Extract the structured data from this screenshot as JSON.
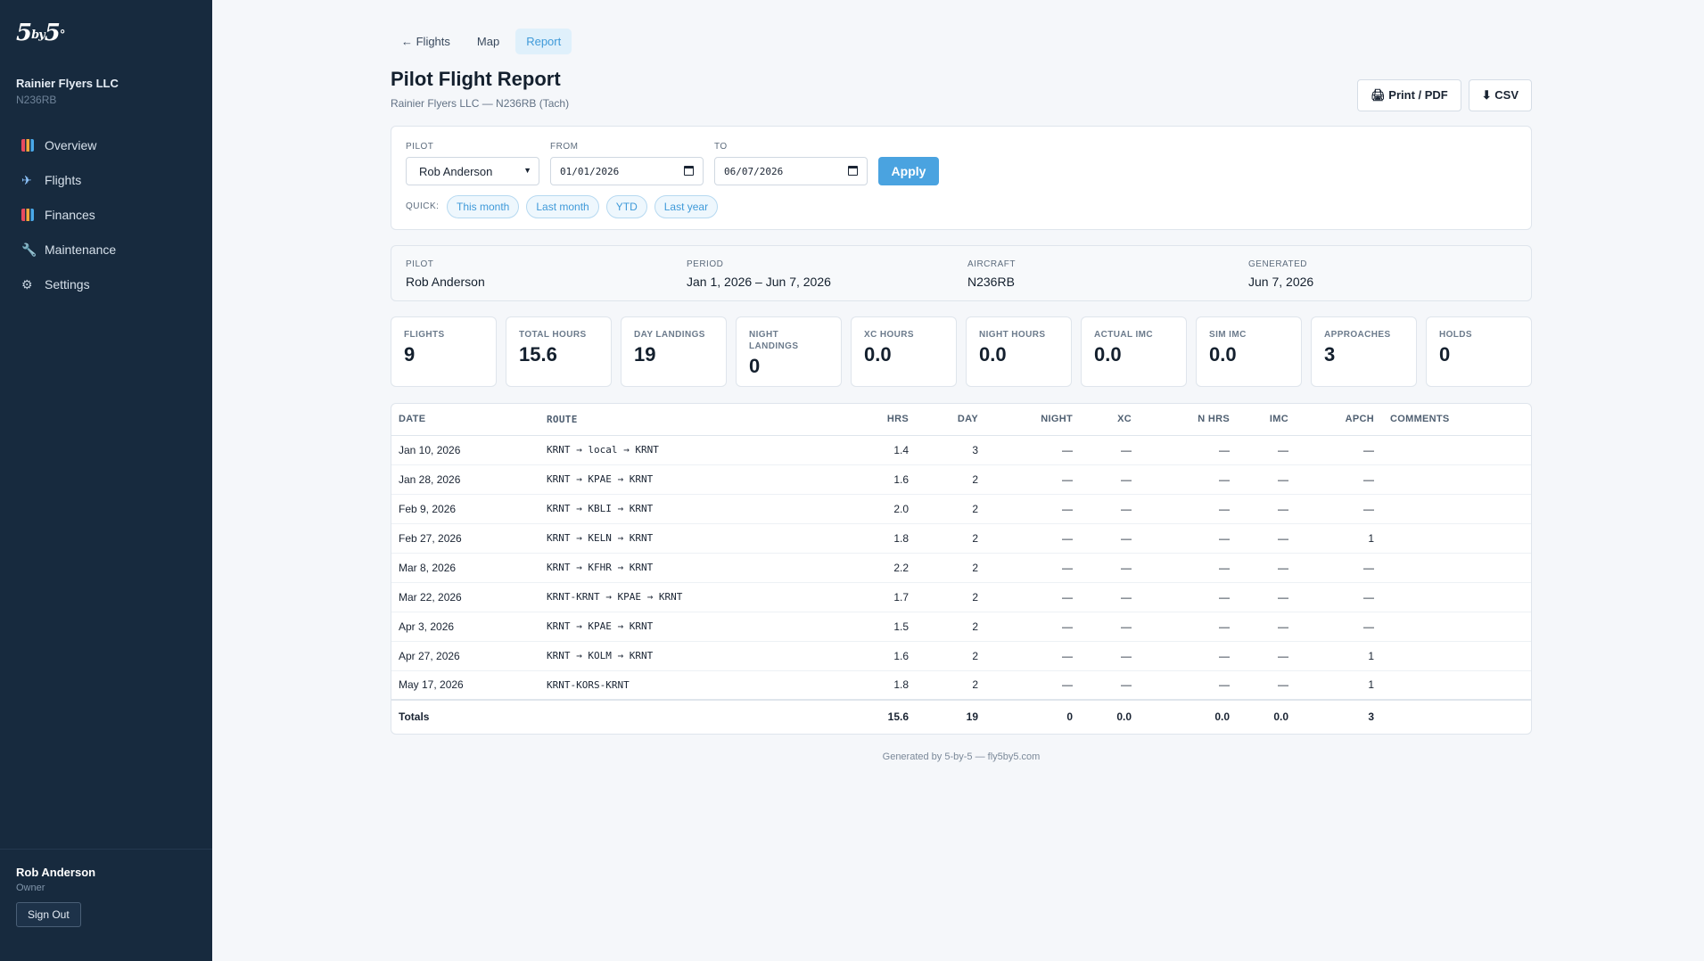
{
  "brand": {
    "logo_main": "5by5",
    "org_name": "Rainier Flyers LLC",
    "tail": "N236RB"
  },
  "nav": [
    {
      "label": "Overview",
      "icon": "chart-icon"
    },
    {
      "label": "Flights",
      "icon": "plane-icon"
    },
    {
      "label": "Finances",
      "icon": "chart-icon"
    },
    {
      "label": "Maintenance",
      "icon": "wrench-icon"
    },
    {
      "label": "Settings",
      "icon": "gear-icon"
    }
  ],
  "user": {
    "name": "Rob Anderson",
    "role": "Owner",
    "signout": "Sign Out"
  },
  "tabs": {
    "back": "← Flights",
    "map": "Map",
    "report": "Report"
  },
  "header": {
    "title": "Pilot Flight Report",
    "subtitle": "Rainier Flyers LLC — N236RB (Tach)",
    "print": "🖨 Print / PDF",
    "csv": "⬇ CSV"
  },
  "filters": {
    "pilot_label": "PILOT",
    "pilot_value": "Rob Anderson",
    "from_label": "FROM",
    "from_value": "01/01/2026",
    "to_label": "TO",
    "to_value": "06/07/2026",
    "apply": "Apply",
    "quick_label": "QUICK:",
    "quick": [
      "This month",
      "Last month",
      "YTD",
      "Last year"
    ]
  },
  "meta": {
    "pilot_label": "PILOT",
    "pilot": "Rob Anderson",
    "period_label": "PERIOD",
    "period": "Jan 1, 2026 – Jun 7, 2026",
    "aircraft_label": "AIRCRAFT",
    "aircraft": "N236RB",
    "generated_label": "GENERATED",
    "generated": "Jun 7, 2026"
  },
  "stats": [
    {
      "label": "FLIGHTS",
      "value": "9"
    },
    {
      "label": "TOTAL HOURS",
      "value": "15.6"
    },
    {
      "label": "DAY LANDINGS",
      "value": "19"
    },
    {
      "label": "NIGHT LANDINGS",
      "value": "0"
    },
    {
      "label": "XC HOURS",
      "value": "0.0"
    },
    {
      "label": "NIGHT HOURS",
      "value": "0.0"
    },
    {
      "label": "ACTUAL IMC",
      "value": "0.0"
    },
    {
      "label": "SIM IMC",
      "value": "0.0"
    },
    {
      "label": "APPROACHES",
      "value": "3"
    },
    {
      "label": "HOLDS",
      "value": "0"
    }
  ],
  "table": {
    "headers": [
      "DATE",
      "ROUTE",
      "HRS",
      "DAY",
      "NIGHT",
      "XC",
      "N HRS",
      "IMC",
      "APCH",
      "COMMENTS"
    ],
    "rows": [
      [
        "Jan 10, 2026",
        "KRNT → local → KRNT",
        "1.4",
        "3",
        "—",
        "—",
        "—",
        "—",
        "—",
        ""
      ],
      [
        "Jan 28, 2026",
        "KRNT → KPAE → KRNT",
        "1.6",
        "2",
        "—",
        "—",
        "—",
        "—",
        "—",
        ""
      ],
      [
        "Feb 9, 2026",
        "KRNT → KBLI → KRNT",
        "2.0",
        "2",
        "—",
        "—",
        "—",
        "—",
        "—",
        ""
      ],
      [
        "Feb 27, 2026",
        "KRNT → KELN → KRNT",
        "1.8",
        "2",
        "—",
        "—",
        "—",
        "—",
        "1",
        ""
      ],
      [
        "Mar 8, 2026",
        "KRNT → KFHR → KRNT",
        "2.2",
        "2",
        "—",
        "—",
        "—",
        "—",
        "—",
        ""
      ],
      [
        "Mar 22, 2026",
        "KRNT-KRNT → KPAE → KRNT",
        "1.7",
        "2",
        "—",
        "—",
        "—",
        "—",
        "—",
        ""
      ],
      [
        "Apr 3, 2026",
        "KRNT → KPAE → KRNT",
        "1.5",
        "2",
        "—",
        "—",
        "—",
        "—",
        "—",
        ""
      ],
      [
        "Apr 27, 2026",
        "KRNT → KOLM → KRNT",
        "1.6",
        "2",
        "—",
        "—",
        "—",
        "—",
        "1",
        ""
      ],
      [
        "May 17, 2026",
        "KRNT-KORS-KRNT",
        "1.8",
        "2",
        "—",
        "—",
        "—",
        "—",
        "1",
        ""
      ]
    ],
    "totals": [
      "Totals",
      "",
      "15.6",
      "19",
      "0",
      "0.0",
      "0.0",
      "0.0",
      "3",
      ""
    ]
  },
  "footer": "Generated by 5-by-5 — fly5by5.com"
}
